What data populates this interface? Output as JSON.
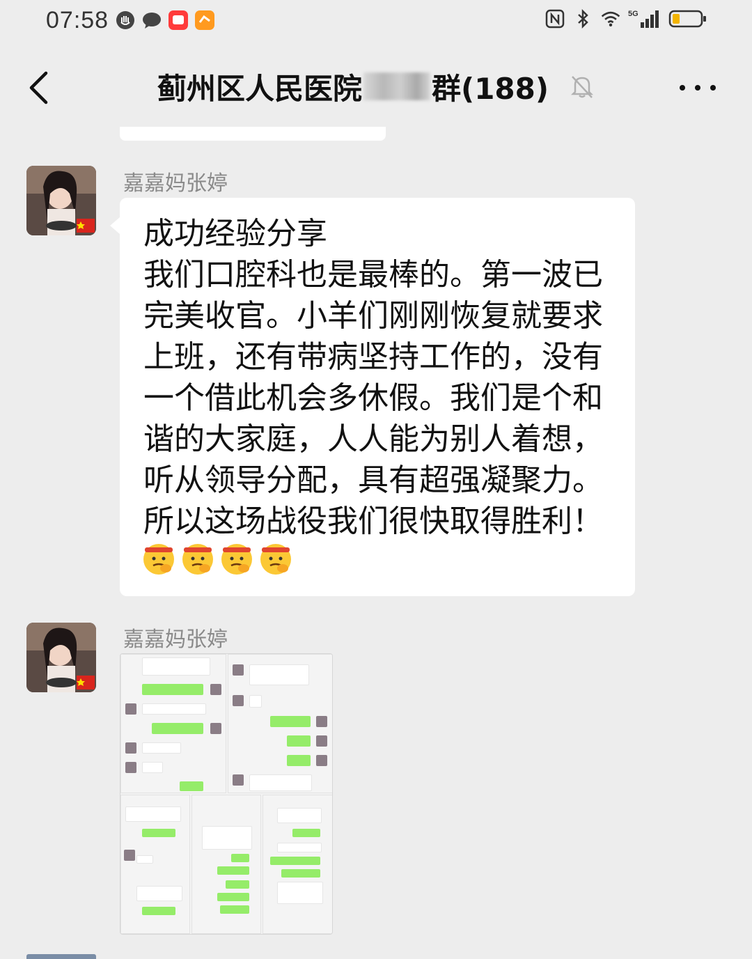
{
  "status_bar": {
    "time": "07:58",
    "left_icons": [
      "hand-icon",
      "chat-bubble-icon",
      "red-app-icon",
      "orange-app-icon"
    ],
    "right_icons": [
      "nfc-icon",
      "bluetooth-icon",
      "wifi-icon",
      "5g-signal-icon",
      "battery-icon"
    ],
    "network_label": "5G"
  },
  "header": {
    "title_prefix": "蓟州区人民医院",
    "title_suffix": "群(188)",
    "back_icon": "chevron-left-icon",
    "mute_icon": "bell-muted-icon",
    "more_icon": "more-dots-icon"
  },
  "messages": [
    {
      "sender": "嘉嘉妈张婷",
      "type": "text",
      "text": "成功经验分享\n我们口腔科也是最棒的。第一波已完美收官。小羊们刚刚恢复就要求上班，还有带病坚持工作的，没有一个借此机会多休假。我们是个和谐的大家庭，人人能为别人着想，听从领导分配，具有超强凝聚力。所以这场战役我们很快取得胜利！",
      "emoji": [
        "salute-emoji",
        "salute-emoji",
        "salute-emoji",
        "salute-emoji"
      ]
    },
    {
      "sender": "嘉嘉妈张婷",
      "type": "image",
      "image_desc_icon": "chat-screenshot-collage-image"
    }
  ],
  "colors": {
    "background": "#ededed",
    "bubble": "#ffffff",
    "sender_name": "#8a8a8a",
    "wechat_green": "#95ec69"
  }
}
